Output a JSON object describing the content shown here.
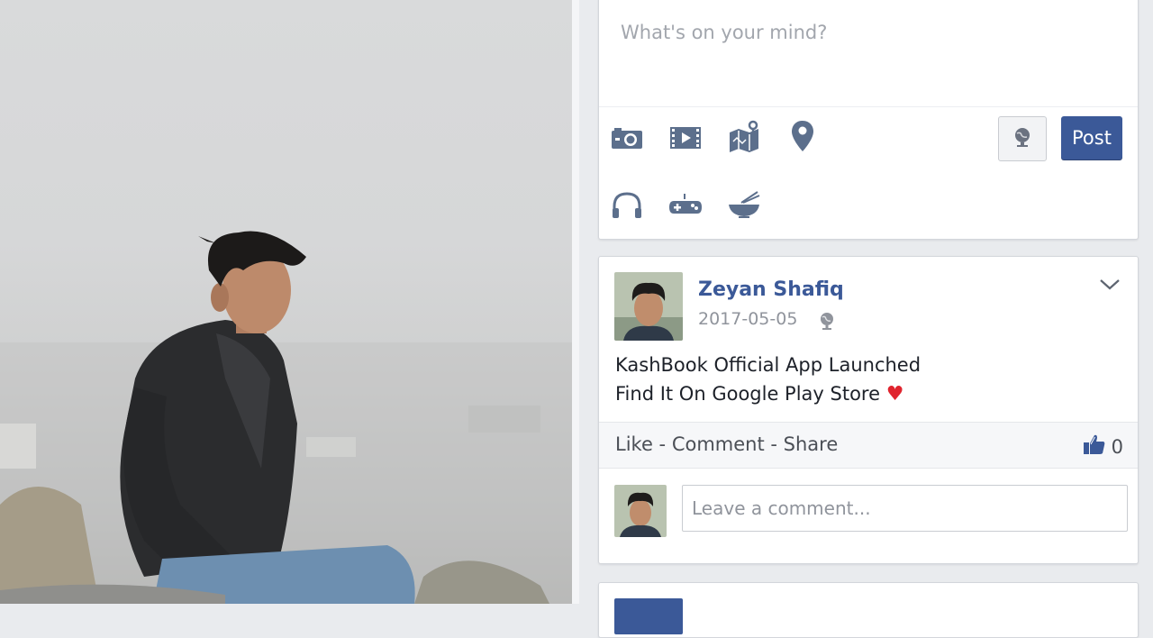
{
  "composer": {
    "placeholder": "What's on your mind?",
    "post_label": "Post",
    "tools": [
      "camera-icon",
      "video-icon",
      "map-icon",
      "location-pin-icon",
      "headphones-icon",
      "gamepad-icon",
      "food-bowl-icon"
    ],
    "privacy_icon": "globe-icon"
  },
  "post": {
    "author": "Zeyan Shafiq",
    "date": "2017-05-05",
    "visibility_icon": "globe-icon",
    "line1": "KashBook Official App Launched",
    "line2": "Find It On Google Play Store",
    "emoji": "♥",
    "like_label": "Like",
    "comment_label": "Comment",
    "share_label": "Share",
    "separator": " - ",
    "like_count": "0",
    "comment_placeholder": "Leave a comment..."
  },
  "colors": {
    "brand": "#3b5998",
    "heart": "#e0242e"
  }
}
